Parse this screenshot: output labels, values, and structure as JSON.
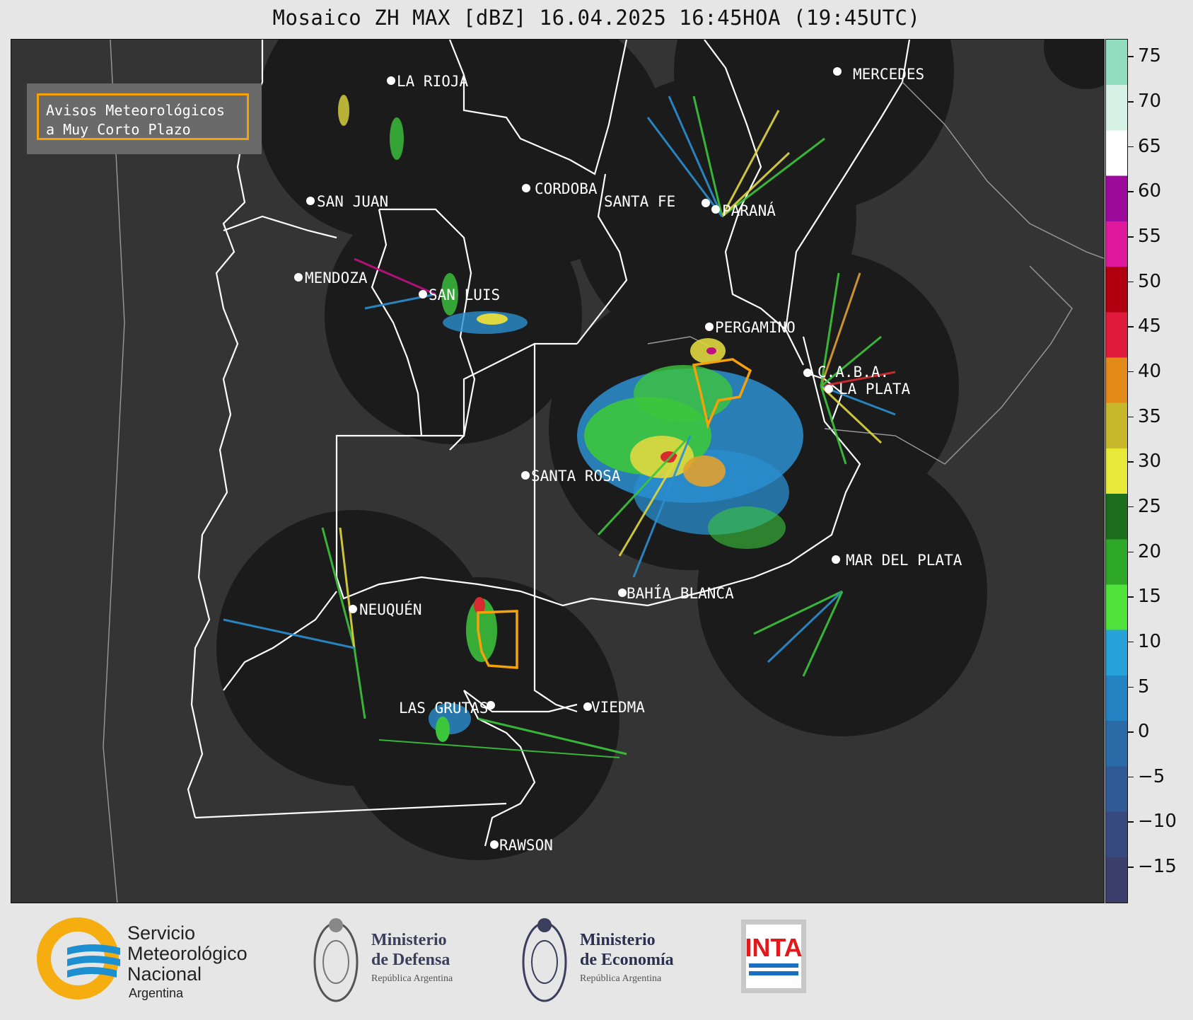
{
  "title": "Mosaico ZH MAX [dBZ] 16.04.2025 16:45HOA (19:45UTC)",
  "legend": {
    "line1": "Avisos Meteorológicos",
    "line2": "a Muy Corto Plazo",
    "border_color": "#f5a10a"
  },
  "cities": [
    {
      "name": "LA RIOJA"
    },
    {
      "name": "MERCEDES"
    },
    {
      "name": "SAN JUAN"
    },
    {
      "name": "CORDOBA"
    },
    {
      "name": "SANTA FE"
    },
    {
      "name": "PARANÁ"
    },
    {
      "name": "MENDOZA"
    },
    {
      "name": "SAN LUIS"
    },
    {
      "name": "PERGAMINO"
    },
    {
      "name": "C.A.B.A."
    },
    {
      "name": "LA PLATA"
    },
    {
      "name": "SANTA ROSA"
    },
    {
      "name": "MAR DEL PLATA"
    },
    {
      "name": "BAHÍA BLANCA"
    },
    {
      "name": "NEUQUÉN"
    },
    {
      "name": "LAS GRUTAS"
    },
    {
      "name": "VIEDMA"
    },
    {
      "name": "RAWSON"
    }
  ],
  "colorbar": {
    "unit": "dBZ",
    "ticks": [
      "75",
      "70",
      "65",
      "60",
      "55",
      "50",
      "45",
      "40",
      "35",
      "30",
      "25",
      "20",
      "15",
      "10",
      "5",
      "0",
      "−5",
      "−10",
      "−15"
    ],
    "range": [
      -19,
      77
    ],
    "colors": [
      "#3c3f6b",
      "#364a7f",
      "#2f5a93",
      "#2a6aa6",
      "#2483c2",
      "#27a2da",
      "#4fe23a",
      "#2fa82a",
      "#1d6e1c",
      "#e8e839",
      "#c8b72a",
      "#e38a1a",
      "#e01a3a",
      "#b00010",
      "#e0189e",
      "#9c0a9c",
      "#ffffff",
      "#d6f2e6",
      "#92dcc0"
    ]
  },
  "footer": {
    "smn_line1": "Servicio",
    "smn_line2": "Meteorológico",
    "smn_line3": "Nacional",
    "smn_line4": "Argentina",
    "defensa_line1": "Ministerio",
    "defensa_line2": "de Defensa",
    "defensa_line3": "República Argentina",
    "economia_line1": "Ministerio",
    "economia_line2": "de Economía",
    "economia_line3": "República Argentina",
    "inta": "INTA"
  }
}
